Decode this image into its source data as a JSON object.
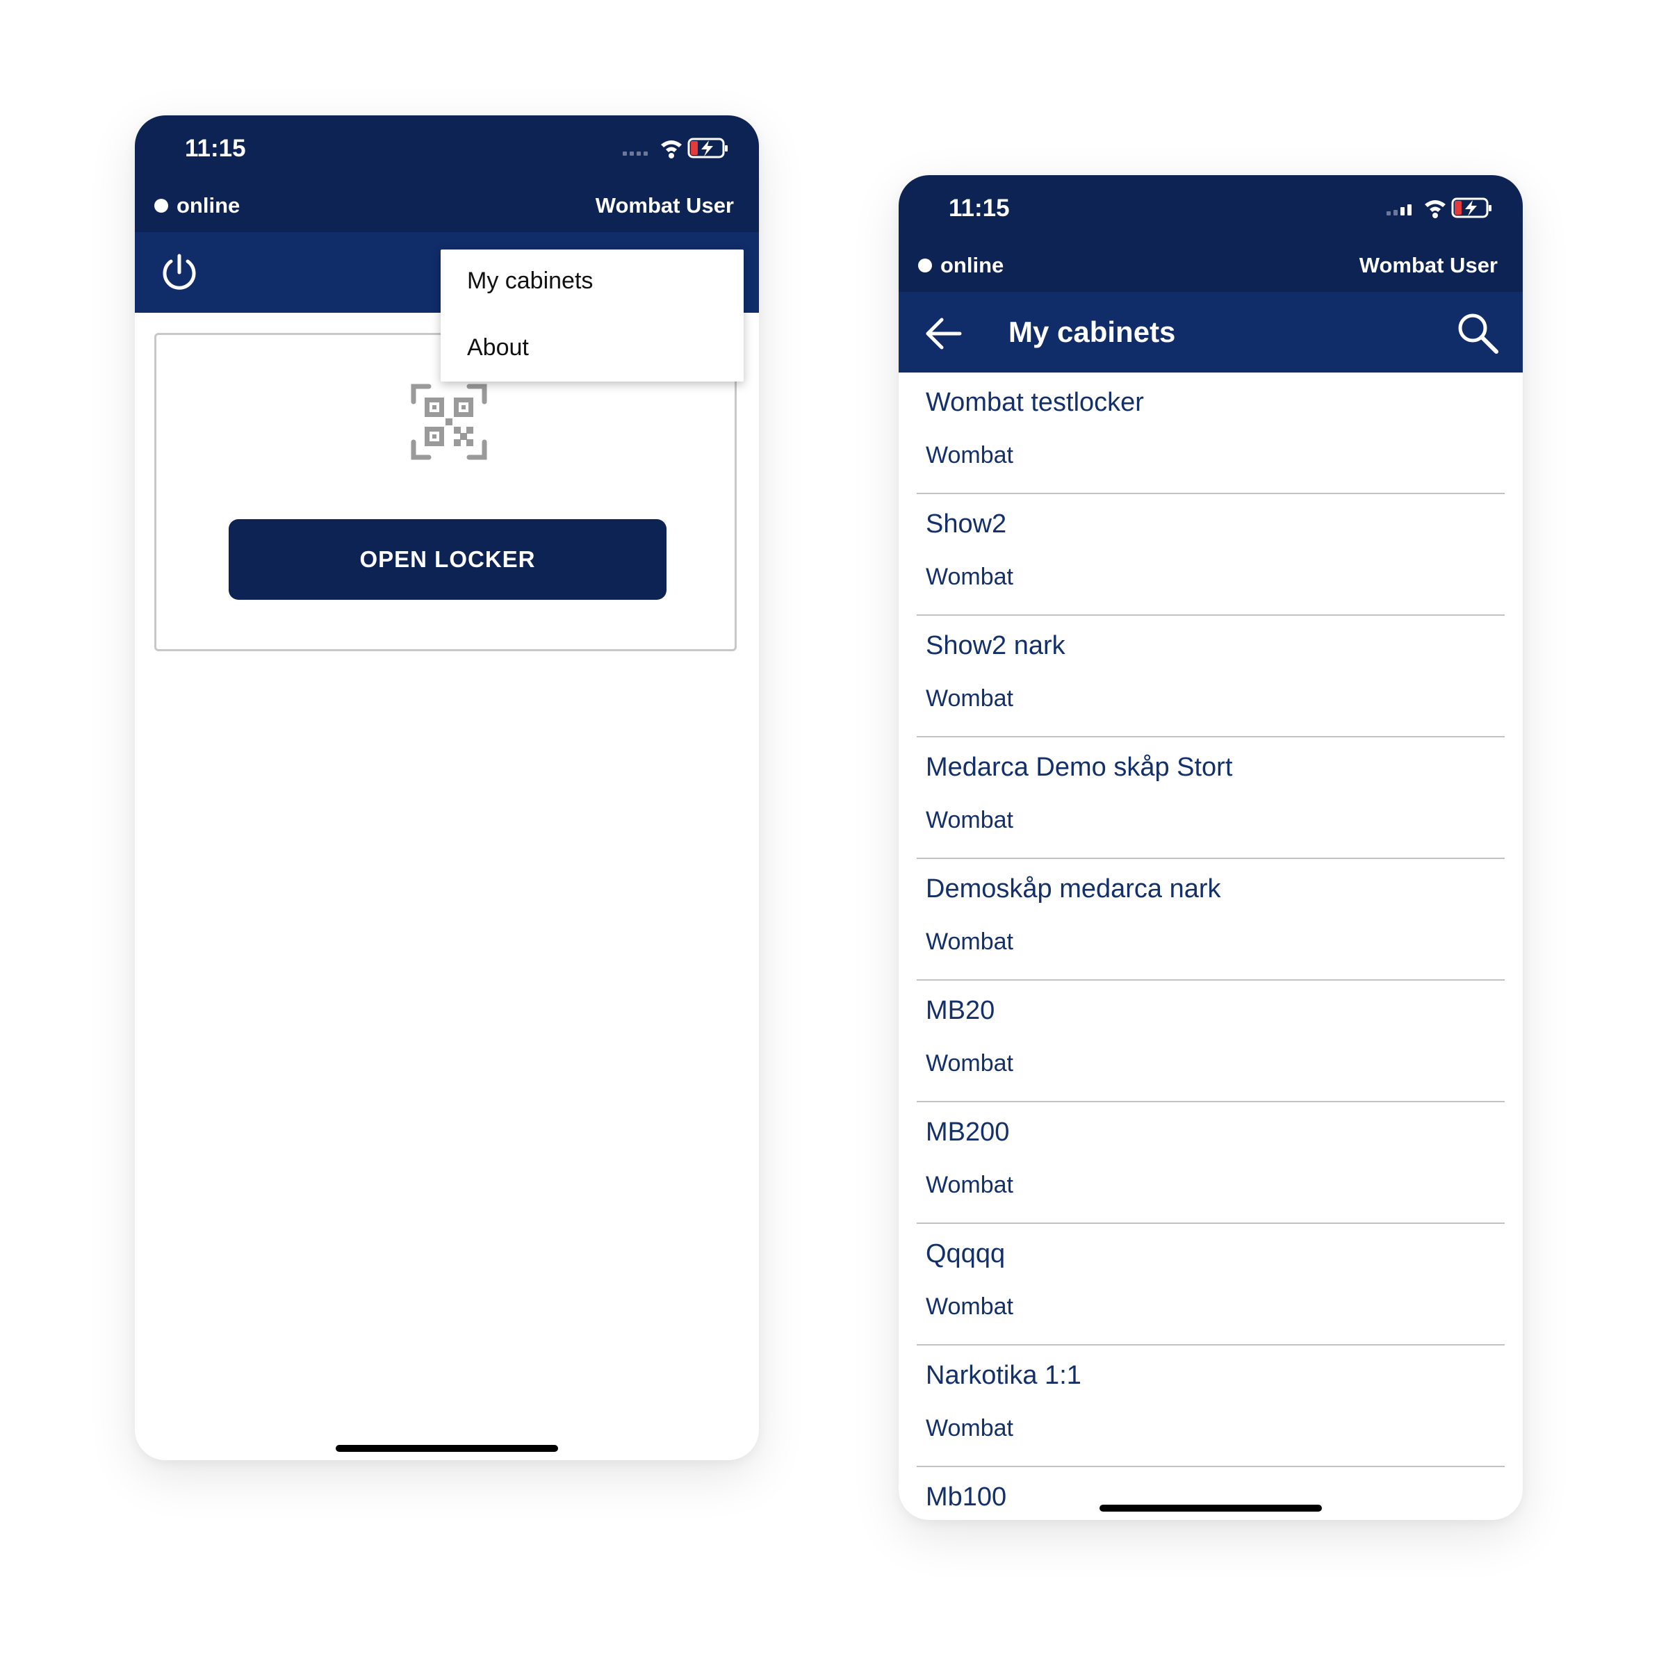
{
  "left": {
    "status": {
      "time": "11:15",
      "connection": "online",
      "user": "Wombat User"
    },
    "menu": {
      "items": [
        "My cabinets",
        "About"
      ]
    },
    "open_locker_label": "OPEN LOCKER",
    "icons": {
      "power": "power-icon",
      "qr": "qr-code-icon"
    }
  },
  "right": {
    "status": {
      "time": "11:15",
      "connection": "online",
      "user": "Wombat User"
    },
    "title": "My cabinets",
    "cabinets": [
      {
        "name": "Wombat testlocker",
        "org": "Wombat"
      },
      {
        "name": "Show2",
        "org": "Wombat"
      },
      {
        "name": "Show2 nark",
        "org": "Wombat"
      },
      {
        "name": "Medarca Demo skåp Stort",
        "org": "Wombat"
      },
      {
        "name": "Demoskåp medarca nark",
        "org": "Wombat"
      },
      {
        "name": "MB20",
        "org": "Wombat"
      },
      {
        "name": "MB200",
        "org": "Wombat"
      },
      {
        "name": "Qqqqq",
        "org": "Wombat"
      },
      {
        "name": "Narkotika 1:1",
        "org": "Wombat"
      },
      {
        "name": "Mb100",
        "org": ""
      }
    ]
  },
  "colors": {
    "status_bar": "#0d2354",
    "toolbar": "#102c69",
    "list_text": "#13306a",
    "button": "#0d2354"
  }
}
